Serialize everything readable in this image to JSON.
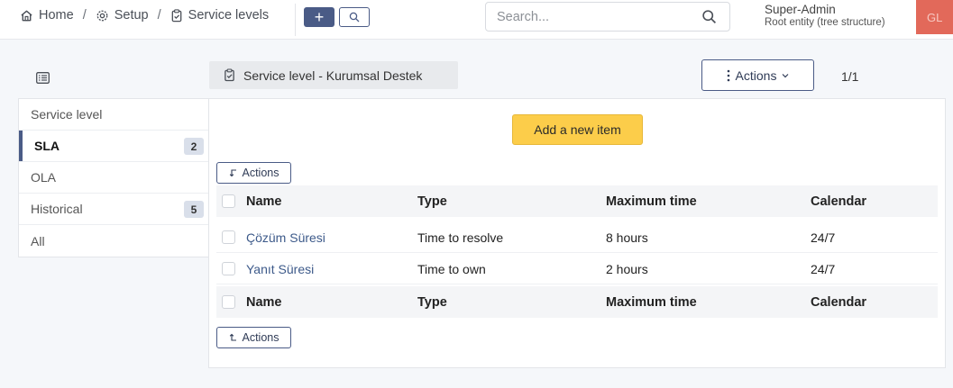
{
  "breadcrumb": {
    "home": "Home",
    "setup": "Setup",
    "current": "Service levels",
    "separator": "/"
  },
  "toolbar": {
    "add_label": "+"
  },
  "search": {
    "placeholder": "Search..."
  },
  "user": {
    "name": "Super-Admin",
    "entity": "Root entity (tree structure)",
    "initials": "GL"
  },
  "page": {
    "title": "Service level - Kurumsal Destek",
    "actions_label": "Actions",
    "pager": "1/1"
  },
  "sidebar": {
    "items": [
      {
        "label": "Service level",
        "badge": null
      },
      {
        "label": "SLA",
        "badge": "2"
      },
      {
        "label": "OLA",
        "badge": null
      },
      {
        "label": "Historical",
        "badge": "5"
      },
      {
        "label": "All",
        "badge": null
      }
    ]
  },
  "main": {
    "add_item_label": "Add a new item",
    "mini_actions_label": "Actions",
    "columns": [
      "Name",
      "Type",
      "Maximum time",
      "Calendar"
    ],
    "rows": [
      {
        "name": "Çözüm Süresi",
        "type": "Time to resolve",
        "max_time": "8 hours",
        "calendar": "24/7"
      },
      {
        "name": "Yanıt Süresi",
        "type": "Time to own",
        "max_time": "2 hours",
        "calendar": "24/7"
      }
    ]
  },
  "colors": {
    "primary": "#4a5b86",
    "add_button": "#fccd4a",
    "avatar": "#e2695a",
    "link": "#3d5a8a"
  },
  "icons": {
    "home": "home-icon",
    "setup": "gear-icon",
    "service_levels": "clipboard-check-icon",
    "search": "search-icon",
    "list_toggle": "list-icon",
    "actions": "vertical-dots-icon",
    "mini_actions_top": "arrow-corner-down-icon",
    "mini_actions_bottom": "arrow-corner-up-icon"
  }
}
